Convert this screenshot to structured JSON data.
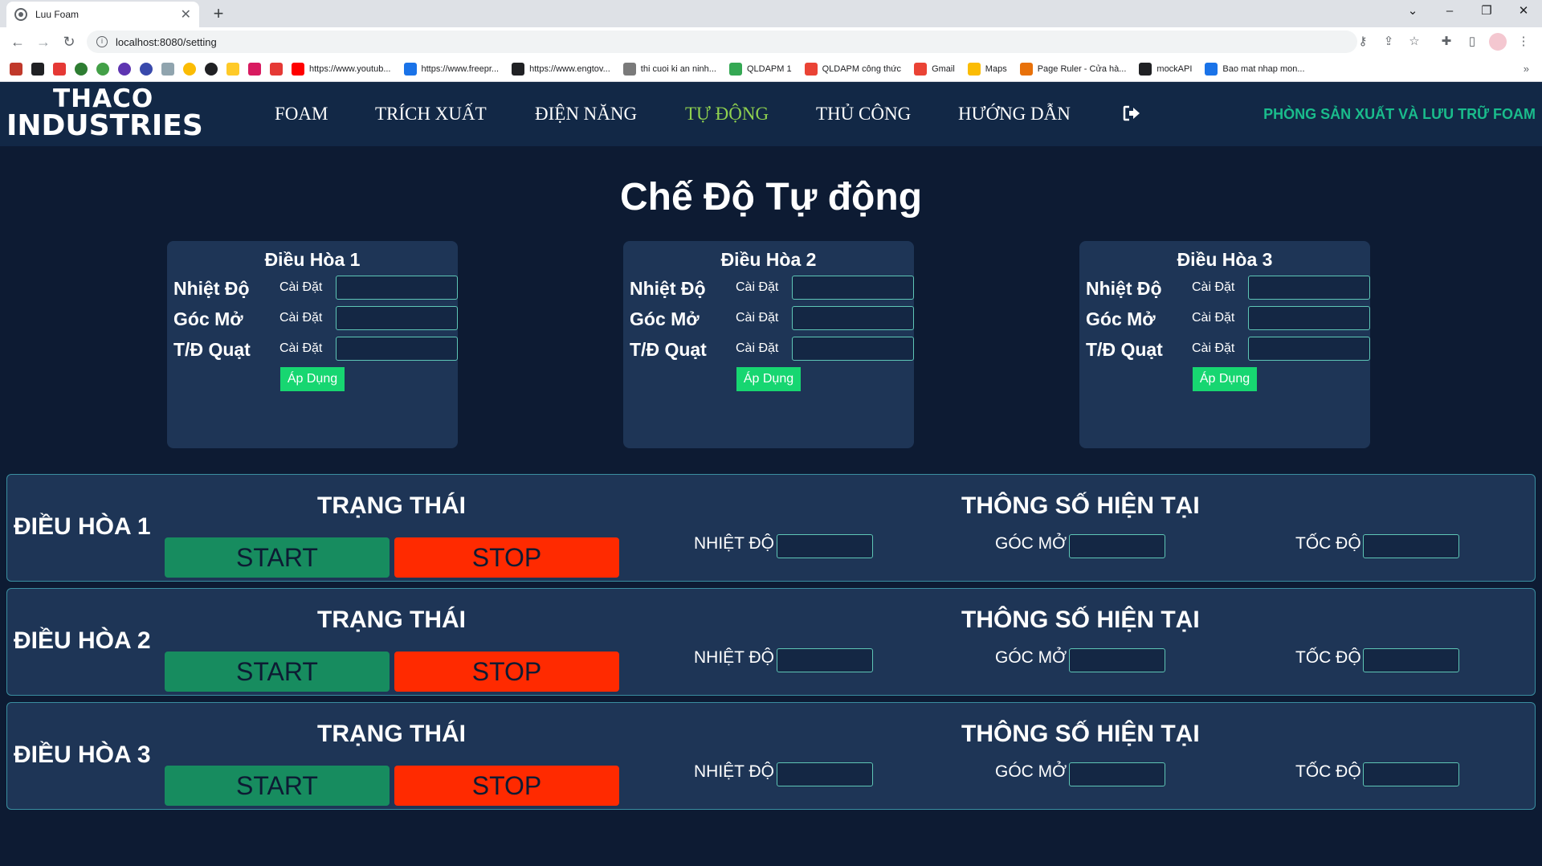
{
  "browser": {
    "tab_title": "Luu Foam",
    "url": "localhost:8080/setting",
    "bookmarks": [
      {
        "label": "https://www.youtub...",
        "color": "#ff0000"
      },
      {
        "label": "https://www.freepr...",
        "color": "#1a73e8"
      },
      {
        "label": "https://www.engtov...",
        "color": "#202124"
      },
      {
        "label": "thi cuoi ki an ninh...",
        "color": "#7a7a7a"
      },
      {
        "label": "QLDAPM 1",
        "color": "#34a853"
      },
      {
        "label": "QLDAPM công thức",
        "color": "#ea4335"
      },
      {
        "label": "Gmail",
        "color": "#ea4335"
      },
      {
        "label": "Maps",
        "color": "#fbbc04"
      },
      {
        "label": "Page Ruler - Cửa hà...",
        "color": "#e8710a"
      },
      {
        "label": "mockAPI",
        "color": "#202124"
      },
      {
        "label": "Bao mat nhap mon...",
        "color": "#1a73e8"
      }
    ]
  },
  "brand": {
    "line1": "THACO",
    "line2": "INDUSTRIES"
  },
  "nav": {
    "items": [
      "FOAM",
      "TRÍCH XUẤT",
      "ĐIỆN NĂNG",
      "TỰ ĐỘNG",
      "THỦ CÔNG",
      "HƯỚNG DẪN"
    ],
    "active": "TỰ ĐỘNG",
    "department": "PHÒNG SẢN XUẤT VÀ LƯU TRỮ FOAM"
  },
  "page_title": "Chế Độ Tự động",
  "settings": {
    "set_label": "Cài Đặt",
    "apply_label": "Áp Dụng",
    "row_labels": [
      "Nhiệt Độ",
      "Góc Mở",
      "T/Đ Quạt"
    ],
    "cards": [
      {
        "title": "Điều Hòa 1",
        "values": [
          "",
          "",
          ""
        ]
      },
      {
        "title": "Điều Hòa 2",
        "values": [
          "",
          "",
          ""
        ]
      },
      {
        "title": "Điều Hòa 3",
        "values": [
          "",
          "",
          ""
        ]
      }
    ]
  },
  "status": {
    "state_heading": "TRẠNG THÁI",
    "params_heading": "THÔNG SỐ HIỆN TẠI",
    "start_label": "START",
    "stop_label": "STOP",
    "temp_label": "NHIỆT ĐỘ",
    "angle_label": "GÓC MỞ",
    "speed_label": "TỐC ĐỘ",
    "units": [
      {
        "name": "ĐIỀU HÒA 1",
        "temp": "",
        "angle": "",
        "speed": ""
      },
      {
        "name": "ĐIỀU HÒA 2",
        "temp": "",
        "angle": "",
        "speed": ""
      },
      {
        "name": "ĐIỀU HÒA 3",
        "temp": "",
        "angle": "",
        "speed": ""
      }
    ]
  },
  "colors": {
    "background": "#0d1b33",
    "navbar": "#122846",
    "panel": "#1e3556",
    "active_menu": "#8fd14f",
    "department": "#1abc8c",
    "apply": "#17d671",
    "start": "#178c5f",
    "stop": "#ff2a00"
  }
}
